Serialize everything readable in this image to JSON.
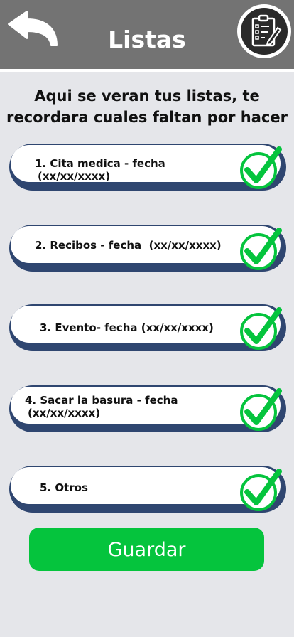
{
  "header": {
    "title": "Listas",
    "back_icon": "back-arrow-icon",
    "clipboard_icon": "clipboard-edit-icon",
    "background_color": "#737373"
  },
  "subtitle": "Aqui se veran tus listas, te recordara cuales faltan por hacer",
  "items": [
    {
      "line1": "1. Cita medica - fecha",
      "line2": "(xx/xx/xxxx)"
    },
    {
      "line1": "2. Recibos - fecha  (xx/xx/xxxx)",
      "line2": ""
    },
    {
      "line1": "3. Evento- fecha (xx/xx/xxxx)",
      "line2": ""
    },
    {
      "line1": "4. Sacar la basura - fecha",
      "line2": "(xx/xx/xxxx)"
    },
    {
      "line1": "5. Otros",
      "line2": ""
    }
  ],
  "check_icon": "checkmark-icon",
  "check_color": "#05c43d",
  "save_button": {
    "label": "Guardar",
    "color": "#05c43d"
  }
}
